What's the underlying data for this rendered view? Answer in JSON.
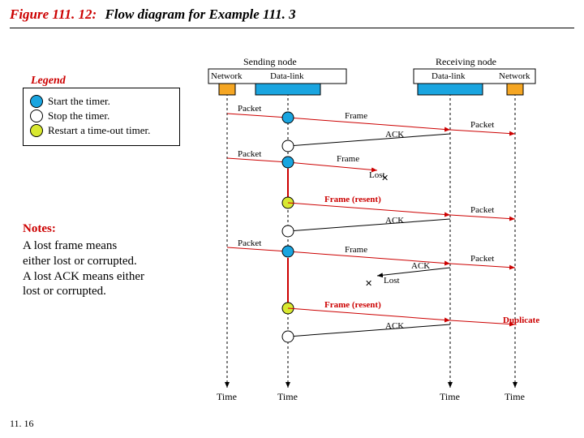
{
  "title": {
    "prefix": "Figure 111. 12:",
    "text": "Flow diagram for Example 111. 3"
  },
  "page_number": "11. 16",
  "legend": {
    "title": "Legend",
    "items": [
      {
        "label": "Start the timer."
      },
      {
        "label": "Stop the timer."
      },
      {
        "label": "Restart a time-out timer."
      }
    ]
  },
  "notes": {
    "title": "Notes:",
    "lines": [
      "A lost frame means",
      "either lost or corrupted.",
      "A lost ACK means either",
      "lost or corrupted."
    ]
  },
  "headers": {
    "sending": "Sending node",
    "receiving": "Receiving node",
    "network": "Network",
    "datalink": "Data-link"
  },
  "events": {
    "packet": "Packet",
    "frame": "Frame",
    "ack": "ACK",
    "frame_resent": "Frame (resent)",
    "lost": "Lost",
    "duplicate": "Duplicate",
    "time": "Time"
  }
}
